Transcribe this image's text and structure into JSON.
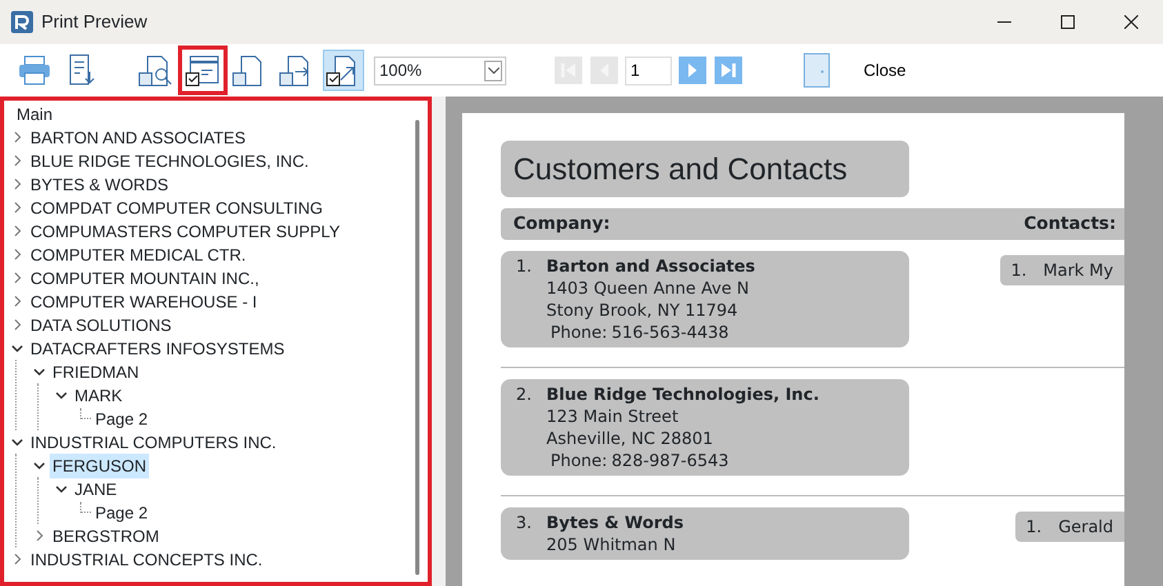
{
  "window": {
    "title": "Print Preview"
  },
  "toolbar": {
    "buttons": [
      {
        "kind": "print",
        "selected": false,
        "highlighted": false
      },
      {
        "kind": "export",
        "selected": false,
        "highlighted": false
      },
      {
        "kind": "zoom-page",
        "selected": false,
        "highlighted": false
      },
      {
        "kind": "outline",
        "selected": false,
        "highlighted": true
      },
      {
        "kind": "single-page",
        "selected": false,
        "highlighted": false
      },
      {
        "kind": "page-next",
        "selected": false,
        "highlighted": false
      },
      {
        "kind": "fit",
        "selected": true,
        "highlighted": false
      }
    ],
    "zoom": "100%",
    "nav": [
      {
        "kind": "first",
        "disabled": true
      },
      {
        "kind": "prev",
        "disabled": true
      }
    ],
    "page": "1",
    "nav2": [
      {
        "kind": "next",
        "disabled": false
      },
      {
        "kind": "last",
        "disabled": false
      }
    ],
    "close": "Close"
  },
  "outline": {
    "highlighted": true,
    "root": "Main",
    "items": [
      {
        "label": "BARTON AND ASSOCIATES",
        "expanded": false,
        "selected": false
      },
      {
        "label": "BLUE RIDGE TECHNOLOGIES, INC.",
        "expanded": false,
        "selected": false
      },
      {
        "label": "BYTES & WORDS",
        "expanded": false,
        "selected": false
      },
      {
        "label": "COMPDAT COMPUTER CONSULTING",
        "expanded": false,
        "selected": false
      },
      {
        "label": "COMPUMASTERS COMPUTER SUPPLY",
        "expanded": false,
        "selected": false
      },
      {
        "label": "COMPUTER MEDICAL CTR.",
        "expanded": false,
        "selected": false
      },
      {
        "label": "COMPUTER MOUNTAIN INC.,",
        "expanded": false,
        "selected": false
      },
      {
        "label": "COMPUTER WAREHOUSE - I",
        "expanded": false,
        "selected": false
      },
      {
        "label": "DATA SOLUTIONS",
        "expanded": false,
        "selected": false
      },
      {
        "label": "DATACRAFTERS INFOSYSTEMS",
        "expanded": true,
        "selected": false,
        "children": [
          {
            "label": "FRIEDMAN",
            "expanded": true,
            "selected": false,
            "children": [
              {
                "label": "MARK",
                "expanded": true,
                "selected": false,
                "children": [
                  {
                    "label": "Page 2",
                    "selected": false
                  }
                ]
              }
            ]
          }
        ]
      },
      {
        "label": "INDUSTRIAL COMPUTERS INC.",
        "expanded": true,
        "selected": false,
        "children": [
          {
            "label": "FERGUSON",
            "expanded": true,
            "selected": true,
            "children": [
              {
                "label": "JANE",
                "expanded": true,
                "selected": false,
                "children": [
                  {
                    "label": "Page 2",
                    "selected": false
                  }
                ]
              }
            ]
          },
          {
            "label": "BERGSTROM",
            "expanded": false,
            "selected": false
          }
        ]
      },
      {
        "label": "INDUSTRIAL CONCEPTS INC.",
        "expanded": false,
        "selected": false
      }
    ]
  },
  "report": {
    "title": "Customers and Contacts",
    "company_header": "Company:",
    "contacts_header": "Contacts:",
    "records": [
      {
        "number": "1.",
        "name": "Barton and Associates",
        "lines": [
          "1403 Queen Anne Ave N",
          "Stony Brook, NY 11794"
        ],
        "phone_label": "Phone:",
        "phone": "516-563-4438",
        "contacts": [
          {
            "number": "1.",
            "name": "Mark My"
          }
        ]
      },
      {
        "number": "2.",
        "name": "Blue Ridge Technologies, Inc.",
        "lines": [
          "123 Main Street",
          "Asheville, NC 28801"
        ],
        "phone_label": "Phone:",
        "phone": "828-987-6543"
      },
      {
        "number": "3.",
        "name": "Bytes & Words",
        "lines": [
          "205 Whitman N"
        ],
        "contacts": [
          {
            "number": "1.",
            "name": "Gerald"
          }
        ]
      }
    ]
  }
}
